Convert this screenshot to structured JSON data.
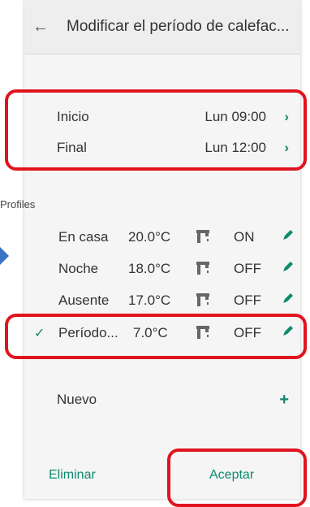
{
  "header": {
    "back_icon": "arrow-left-icon",
    "title": "Modificar el período de calefac..."
  },
  "schedule": {
    "start_label": "Inicio",
    "start_value": "Lun 09:00",
    "end_label": "Final",
    "end_value": "Lun 12:00"
  },
  "profiles": {
    "section_label": "Profiles",
    "items": [
      {
        "name": "En casa",
        "temp": "20.0°C",
        "state": "ON",
        "selected": false
      },
      {
        "name": "Noche",
        "temp": "18.0°C",
        "state": "OFF",
        "selected": false
      },
      {
        "name": "Ausente",
        "temp": "17.0°C",
        "state": "OFF",
        "selected": false
      },
      {
        "name": "Período...",
        "temp": "7.0°C",
        "state": "OFF",
        "selected": true
      }
    ],
    "new_label": "Nuevo"
  },
  "footer": {
    "delete_label": "Eliminar",
    "accept_label": "Aceptar"
  },
  "colors": {
    "accent": "#0d8a6d",
    "highlight": "#e0141e",
    "pointer_arrow": "#3a73c4"
  }
}
